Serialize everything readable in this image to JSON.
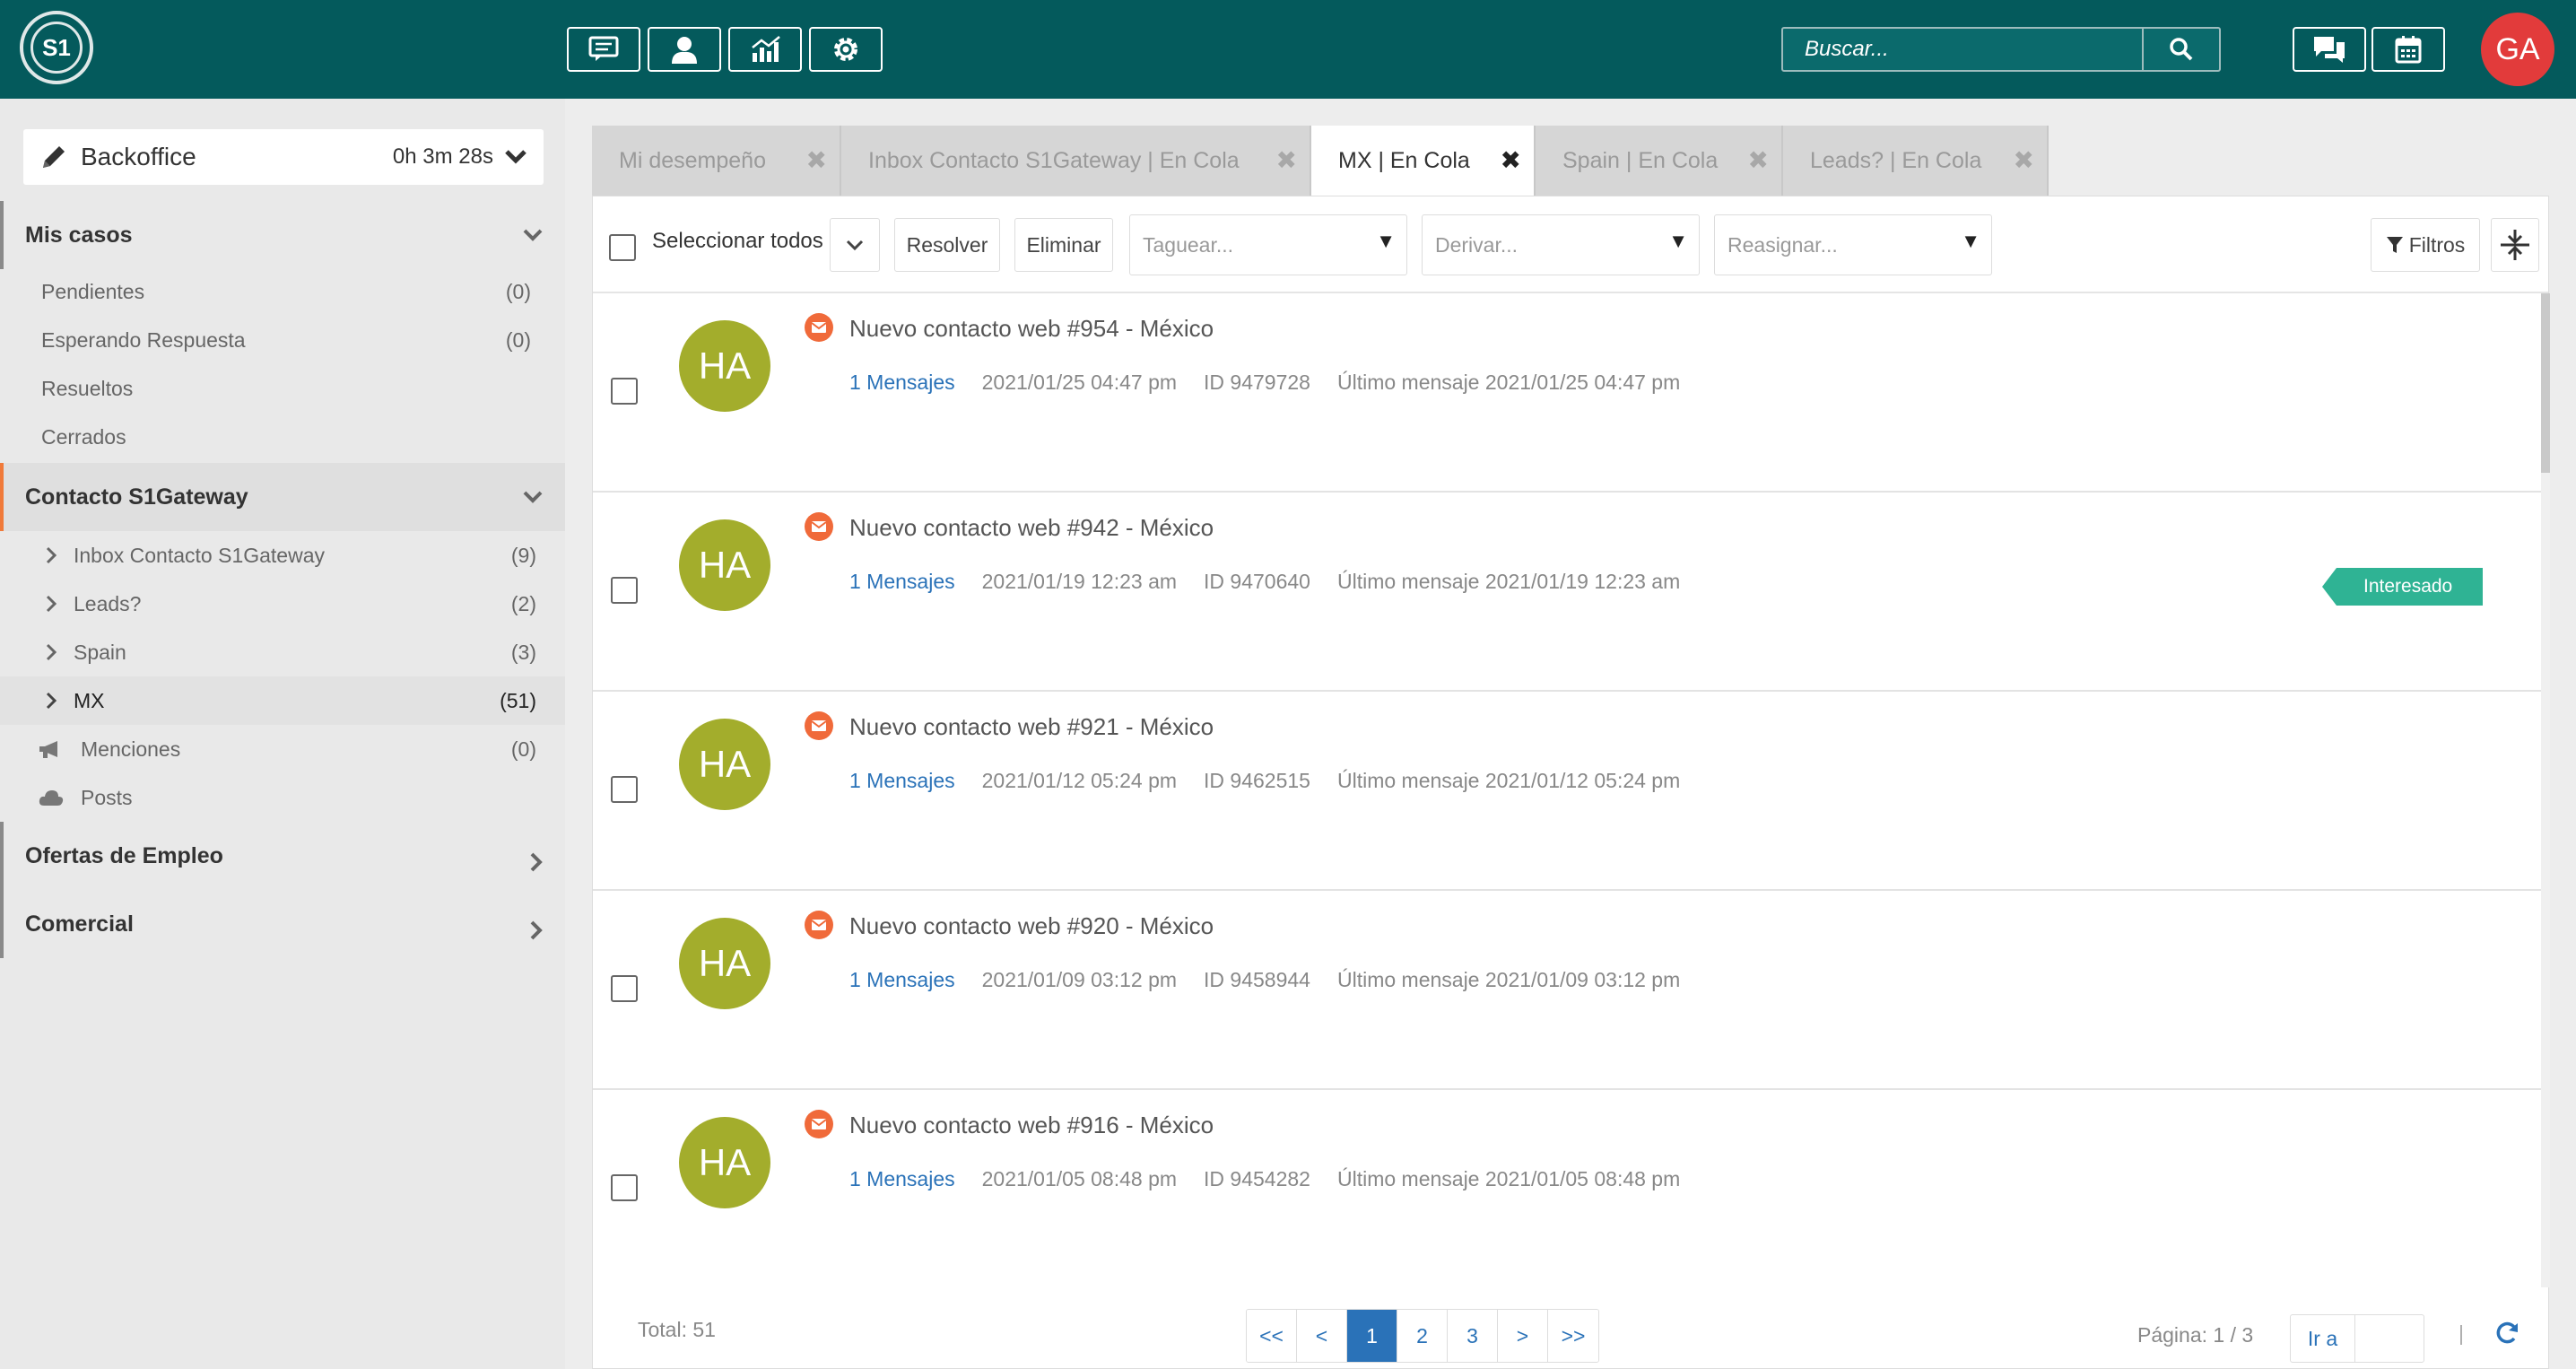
{
  "header": {
    "logo_text": "S1",
    "icons": [
      "chat-icon",
      "contacts-icon",
      "stats-icon",
      "settings-icon"
    ],
    "search_placeholder": "Buscar...",
    "user_initials": "GA",
    "colors": {
      "topbar": "#045a5c",
      "avatar": "#e23b3b"
    }
  },
  "sidebar": {
    "backoffice": {
      "title": "Backoffice",
      "timer": "0h 3m 28s"
    },
    "sections": [
      {
        "title": "Mis casos",
        "items": [
          {
            "label": "Pendientes",
            "count": "(0)"
          },
          {
            "label": "Esperando Respuesta",
            "count": "(0)"
          },
          {
            "label": "Resueltos",
            "count": ""
          },
          {
            "label": "Cerrados",
            "count": ""
          }
        ]
      },
      {
        "title": "Contacto S1Gateway",
        "items": [
          {
            "label": "Inbox Contacto S1Gateway",
            "count": "(9)"
          },
          {
            "label": "Leads?",
            "count": "(2)"
          },
          {
            "label": "Spain",
            "count": "(3)"
          },
          {
            "label": "MX",
            "count": "(51)"
          },
          {
            "label": "Menciones",
            "count": "(0)"
          },
          {
            "label": "Posts",
            "count": ""
          }
        ]
      },
      {
        "title": "Ofertas de Empleo"
      },
      {
        "title": "Comercial"
      }
    ]
  },
  "tabs": [
    {
      "label": "Mi desempeño"
    },
    {
      "label": "Inbox Contacto S1Gateway | En Cola"
    },
    {
      "label": "MX | En Cola"
    },
    {
      "label": "Spain | En Cola"
    },
    {
      "label": "Leads? | En Cola"
    }
  ],
  "toolbar": {
    "select_all": "Seleccionar todos",
    "resolve": "Resolver",
    "delete": "Eliminar",
    "tag_placeholder": "Taguear...",
    "derive_placeholder": "Derivar...",
    "reassign_placeholder": "Reasignar...",
    "filters": "Filtros"
  },
  "cases": [
    {
      "initials": "HA",
      "title": "Nuevo contacto web #954 - México",
      "messages": "1 Mensajes",
      "date": "2021/01/25 04:47 pm",
      "id": "ID 9479728",
      "last": "Último mensaje 2021/01/25 04:47 pm",
      "tag": ""
    },
    {
      "initials": "HA",
      "title": "Nuevo contacto web #942 - México",
      "messages": "1 Mensajes",
      "date": "2021/01/19 12:23 am",
      "id": "ID 9470640",
      "last": "Último mensaje 2021/01/19 12:23 am",
      "tag": "Interesado"
    },
    {
      "initials": "HA",
      "title": "Nuevo contacto web #921 - México",
      "messages": "1 Mensajes",
      "date": "2021/01/12 05:24 pm",
      "id": "ID 9462515",
      "last": "Último mensaje 2021/01/12 05:24 pm",
      "tag": ""
    },
    {
      "initials": "HA",
      "title": "Nuevo contacto web #920 - México",
      "messages": "1 Mensajes",
      "date": "2021/01/09 03:12 pm",
      "id": "ID 9458944",
      "last": "Último mensaje 2021/01/09 03:12 pm",
      "tag": ""
    },
    {
      "initials": "HA",
      "title": "Nuevo contacto web #916 - México",
      "messages": "1 Mensajes",
      "date": "2021/01/05 08:48 pm",
      "id": "ID 9454282",
      "last": "Último mensaje 2021/01/05 08:48 pm",
      "tag": ""
    }
  ],
  "footer": {
    "total": "Total: 51",
    "pages": [
      "<<",
      "<",
      "1",
      "2",
      "3",
      ">",
      ">>"
    ],
    "current_page": "1",
    "page_info": "Página: 1 / 3",
    "goto": "Ir a",
    "separator": "|"
  }
}
